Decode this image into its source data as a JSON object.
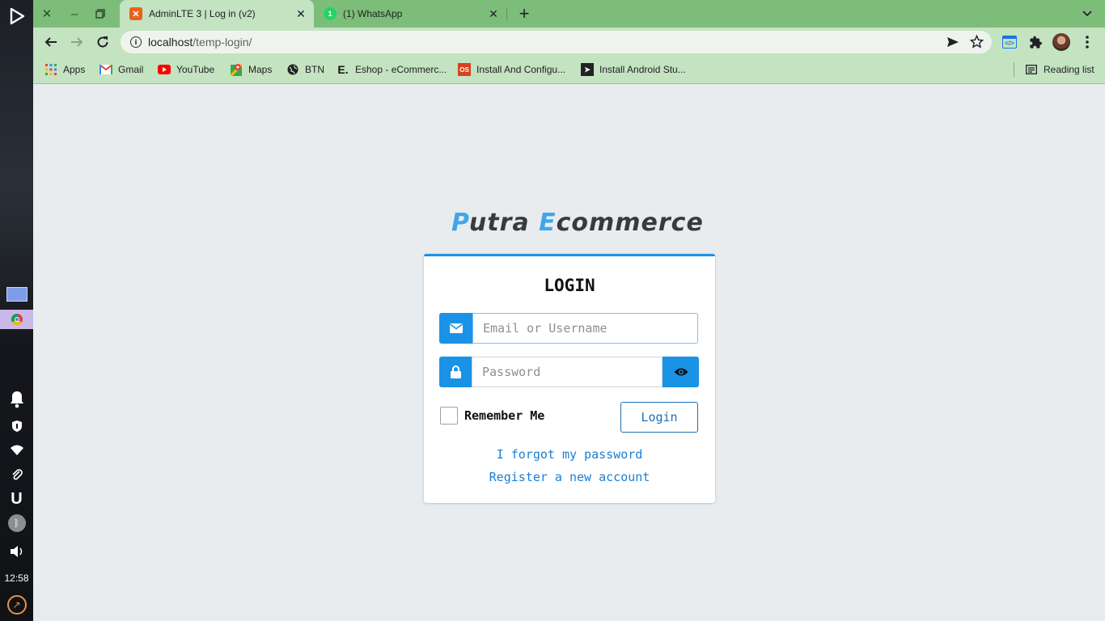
{
  "shelf": {
    "time": "12:58"
  },
  "browser": {
    "tabs": [
      {
        "title": "AdminLTE 3 | Log in (v2)",
        "active": true
      },
      {
        "title": "(1) WhatsApp",
        "active": false
      }
    ],
    "new_tab_label": "+",
    "url_host": "localhost",
    "url_path": "/temp-login/",
    "bookmarks": [
      {
        "label": "Apps",
        "icon": "apps-grid-icon"
      },
      {
        "label": "Gmail",
        "icon": "gmail-icon"
      },
      {
        "label": "YouTube",
        "icon": "youtube-icon"
      },
      {
        "label": "Maps",
        "icon": "maps-icon"
      },
      {
        "label": "BTN",
        "icon": "globe-icon"
      },
      {
        "label": "Eshop - eCommerc...",
        "icon": "eshop-icon"
      },
      {
        "label": "Install And Configu...",
        "icon": "os-icon"
      },
      {
        "label": "Install Android Stu...",
        "icon": "arrow-site-icon"
      }
    ],
    "reading_list": "Reading list"
  },
  "page": {
    "brand_first_cap": "P",
    "brand_first_rest": "utra ",
    "brand_second_cap": "E",
    "brand_second_rest": "commerce",
    "login_title": "LOGIN",
    "email_placeholder": "Email or Username",
    "password_placeholder": "Password",
    "remember_label": "Remember Me",
    "login_button": "Login",
    "forgot_link": "I forgot my password",
    "register_link": "Register a new account"
  },
  "colors": {
    "tab_strip": "#7dbd7a",
    "toolbar": "#c4e3c1",
    "accent": "#1a93e6"
  }
}
